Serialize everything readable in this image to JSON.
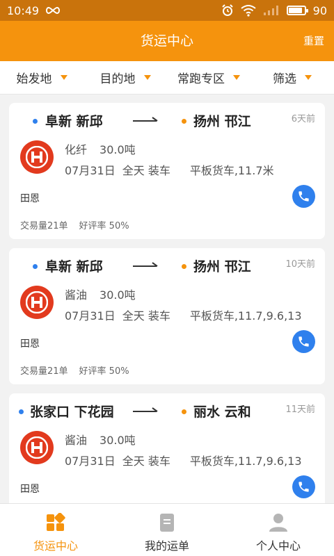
{
  "status_bar": {
    "time": "10:49",
    "battery": "90",
    "battery_level": 0.9
  },
  "header": {
    "title": "货运中心",
    "reset_label": "重置"
  },
  "filters": [
    {
      "label": "始发地"
    },
    {
      "label": "目的地"
    },
    {
      "label": "常跑专区"
    },
    {
      "label": "筛选"
    }
  ],
  "colors": {
    "accent": "#f5930d",
    "origin_dot": "#2f80ed",
    "dest_dot": "#f5930d",
    "logo": "#e23a1e",
    "phone": "#2f80ed"
  },
  "cards": [
    {
      "from": "阜新 新邱",
      "to": "扬州 邗江",
      "ago": "6天前",
      "goods": "化纤",
      "weight": "30.0吨",
      "date": "07月31日",
      "time": "全天 装车",
      "truck": "平板货车,11.7米",
      "name": "田恩",
      "deals": "交易量21单",
      "rating": "好评率  50%"
    },
    {
      "from": "阜新 新邱",
      "to": "扬州 邗江",
      "ago": "10天前",
      "goods": "酱油",
      "weight": "30.0吨",
      "date": "07月31日",
      "time": "全天 装车",
      "truck": "平板货车,11.7,9.6,13",
      "name": "田恩",
      "deals": "交易量21单",
      "rating": "好评率  50%"
    },
    {
      "from": "张家口 下花园",
      "to": "丽水 云和",
      "ago": "11天前",
      "goods": "酱油",
      "weight": "30.0吨",
      "date": "07月31日",
      "time": "全天 装车",
      "truck": "平板货车,11.7,9.6,13",
      "name": "田恩",
      "deals": "",
      "rating": ""
    }
  ],
  "tabbar": [
    {
      "label": "货运中心",
      "icon": "freight-grid-icon",
      "active": true
    },
    {
      "label": "我的运单",
      "icon": "waybill-icon",
      "active": false
    },
    {
      "label": "个人中心",
      "icon": "person-icon",
      "active": false
    }
  ]
}
